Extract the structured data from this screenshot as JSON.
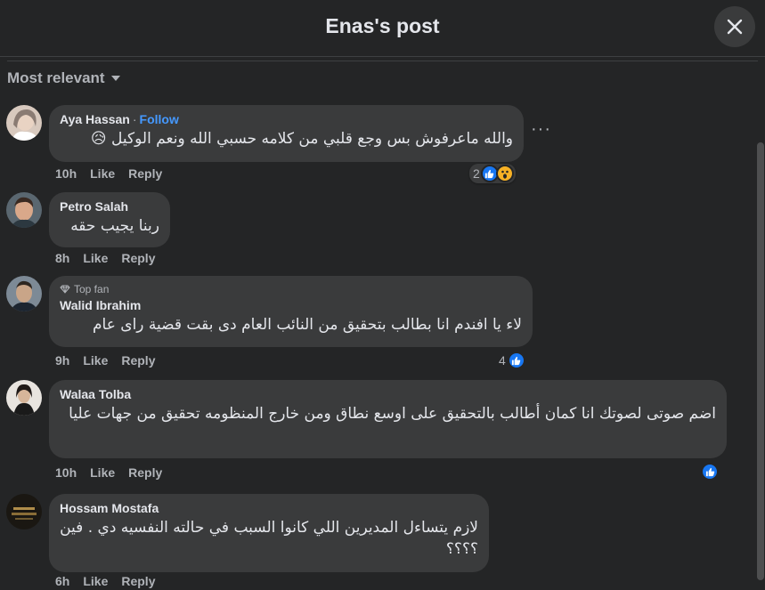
{
  "header": {
    "title": "Enas's post"
  },
  "sort": {
    "label": "Most relevant"
  },
  "comments": [
    {
      "author": "Aya Hassan",
      "follow": "Follow",
      "separator": "·",
      "text": "والله ماعرفوش بس وجع قلبي من كلامه حسبي الله ونعم الوكيل 😥",
      "time": "10h",
      "like": "Like",
      "reply": "Reply",
      "reactions": "2"
    },
    {
      "author": "Petro Salah",
      "text": "ربنا يجيب حقه",
      "time": "8h",
      "like": "Like",
      "reply": "Reply"
    },
    {
      "badge": "Top fan",
      "author": "Walid Ibrahim",
      "text": "لاء يا افندم انا بطالب بتحقيق من النائب العام دى بقت قضية راى عام",
      "time": "9h",
      "like": "Like",
      "reply": "Reply",
      "reactions": "4"
    },
    {
      "author": "Walaa Tolba",
      "text": "اضم صوتى لصوتك انا كمان أطالب بالتحقيق على اوسع نطاق ومن خارج المنظومه تحقيق من جهات عليا",
      "time": "10h",
      "like": "Like",
      "reply": "Reply"
    },
    {
      "author": "Hossam Mostafa",
      "text": "لازم يتساءل المديرين اللي كانوا السبب في حالته النفسيه دي . فين ؟؟؟؟",
      "time": "6h",
      "like": "Like",
      "reply": "Reply"
    }
  ],
  "colors": {
    "background": "#242526",
    "bubble": "#3a3b3c",
    "accent": "#4599ff",
    "like": "#1877f2"
  }
}
